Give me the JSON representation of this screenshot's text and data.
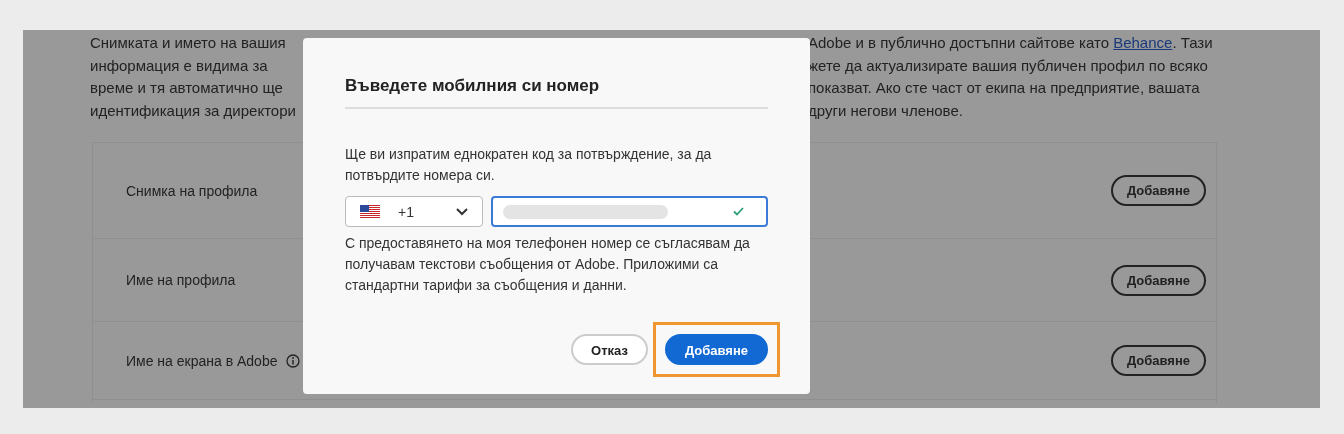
{
  "background": {
    "intro_lines": [
      {
        "left": "Снимката и името на вашия",
        "right": "Adobe и в публично достъпни сайтове като ",
        "link": "Behance",
        "after": ". Тази"
      },
      {
        "left": "информация е видима за",
        "right": "жете да актуализирате вашия публичен профил по всяко"
      },
      {
        "left": "време и тя автоматично ще",
        "right": "показват. Ако сте част от екипа на предприятие, вашата"
      },
      {
        "left": "идентификация за директори",
        "right": "други негови членове."
      }
    ],
    "rows": [
      {
        "label": "Снимка на профила",
        "info": false,
        "button": "Добавяне"
      },
      {
        "label": "Име на профила",
        "info": false,
        "button": "Добавяне"
      },
      {
        "label": "Име на екрана в Adobe",
        "info": true,
        "button": "Добавяне"
      }
    ]
  },
  "dialog": {
    "title": "Въведете мобилния си номер",
    "message": "Ще ви изпратим еднократен код за потвърждение, за да потвърдите номера си.",
    "country_code": "+1",
    "phone": {
      "valid": true
    },
    "consent": "С предоставянето на моя телефонен номер се съгласявам да получавам текстови съобщения от Adobe. Приложими са стандартни тарифи за съобщения и данни.",
    "buttons": [
      {
        "label": "Отказ",
        "kind": "secondary",
        "highlighted": false
      },
      {
        "label": "Добавяне",
        "kind": "primary",
        "highlighted": true
      }
    ]
  }
}
